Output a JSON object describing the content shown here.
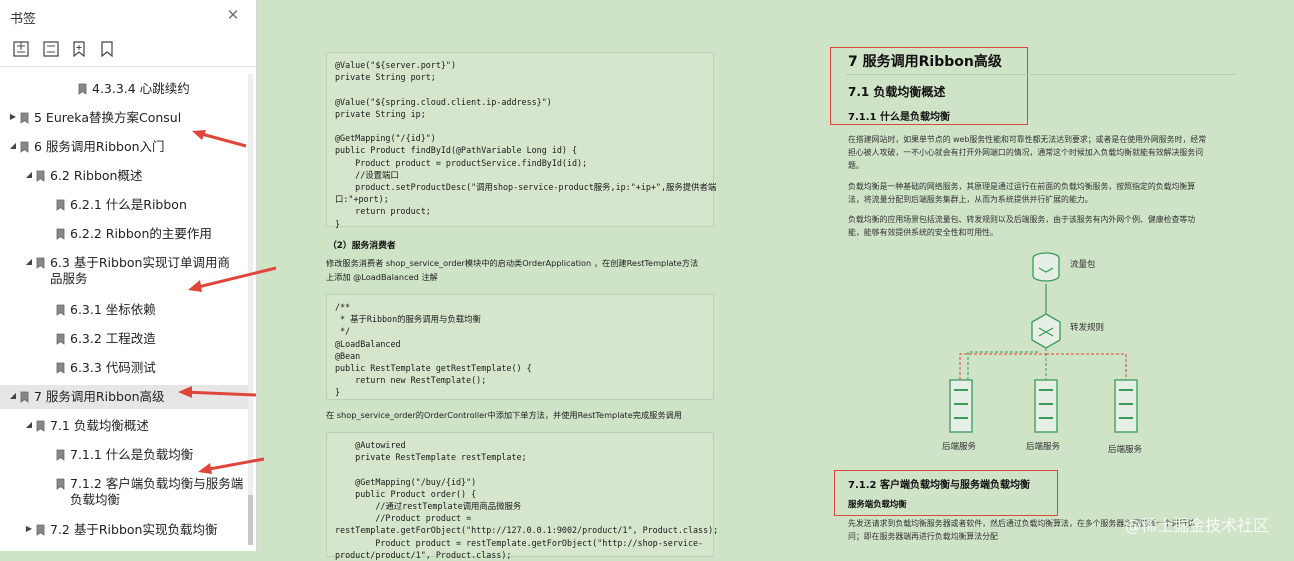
{
  "sidebar": {
    "title": "书签",
    "tools": [
      "expand-all-icon",
      "collapse-all-icon",
      "add-bookmark-icon",
      "bookmark-outline-icon"
    ],
    "items": [
      {
        "label": "4.3.3.4 心跳续约",
        "level": 3,
        "caret": "none"
      },
      {
        "label": "5 Eureka替换方案Consul",
        "level": 0,
        "caret": "right"
      },
      {
        "label": "6 服务调用Ribbon入门",
        "level": 0,
        "caret": "down"
      },
      {
        "label": "6.2 Ribbon概述",
        "level": 1,
        "caret": "down"
      },
      {
        "label": "6.2.1 什么是Ribbon",
        "level": 2,
        "caret": "none"
      },
      {
        "label": "6.2.2 Ribbon的主要作用",
        "level": 2,
        "caret": "none"
      },
      {
        "label": "6.3 基于Ribbon实现订单调用商",
        "label2": "品服务",
        "level": 1,
        "caret": "down"
      },
      {
        "label": "6.3.1 坐标依赖",
        "level": 2,
        "caret": "none"
      },
      {
        "label": "6.3.2 工程改造",
        "level": 2,
        "caret": "none"
      },
      {
        "label": "6.3.3 代码测试",
        "level": 2,
        "caret": "none"
      },
      {
        "label": "7 服务调用Ribbon高级",
        "level": 0,
        "caret": "down",
        "selected": true
      },
      {
        "label": "7.1 负载均衡概述",
        "level": 1,
        "caret": "down"
      },
      {
        "label": "7.1.1 什么是负载均衡",
        "level": 2,
        "caret": "none"
      },
      {
        "label": "7.1.2 客户端负载均衡与服务端",
        "label2": "负载均衡",
        "level": 2,
        "caret": "none"
      },
      {
        "label": "7.2 基于Ribbon实现负载均衡",
        "level": 1,
        "caret": "right"
      }
    ]
  },
  "left_page": {
    "code1": [
      "@Value(\"${server.port}\")",
      "private String port;",
      "",
      "@Value(\"${spring.cloud.client.ip-address}\")",
      "private String ip;",
      "",
      "@GetMapping(\"/{id}\")",
      "public Product findById(@PathVariable Long id) {",
      "    Product product = productService.findById(id);",
      "    //设置端口",
      "    product.setProductDesc(\"调用shop-service-product服务,ip:\"+ip+\",服务提供者端",
      "口:\"+port);",
      "    return product;",
      "}"
    ],
    "consumer_heading": "（2）服务消费者",
    "para1": "修改服务消费者 shop_service_order模块中的启动类OrderApplication ，在创建RestTemplate方法",
    "para1b": "上添加 @LoadBalanced 注解",
    "code2": [
      "/**",
      " * 基于Ribbon的服务调用与负载均衡",
      " */",
      "@LoadBalanced",
      "@Bean",
      "public RestTemplate getRestTemplate() {",
      "    return new RestTemplate();",
      "}"
    ],
    "para2": "在 shop_service_order的OrderController中添加下单方法，并使用RestTemplate完成服务调用",
    "code3": [
      "    @Autowired",
      "    private RestTemplate restTemplate;",
      "",
      "    @GetMapping(\"/buy/{id}\")",
      "    public Product order() {",
      "        //通过restTemplate调用商品微服务",
      "        //Product product =",
      "restTemplate.getForObject(\"http://127.0.0.1:9002/product/1\", Product.class);",
      "        Product product = restTemplate.getForObject(\"http://shop-service-",
      "product/product/1\", Product.class);"
    ]
  },
  "right_page": {
    "h1": "7 服务调用Ribbon高级",
    "h2": "7.1 负载均衡概述",
    "h3": "7.1.1 什么是负载均衡",
    "p1a": "在搭建网站时，如果单节点的 web服务性能和可靠性都无法达到要求；或者是在使用外网服务时，经常",
    "p1b": "担心被人攻破，一不小心就会有打开外网端口的情况，通常这个时候加入负载均衡就能有效解决服务问",
    "p1c": "题。",
    "p2a": "负载均衡是一种基础的网络服务，其原理是通过运行在前面的负载均衡服务，按照指定的负载均衡算",
    "p2b": "法，将流量分配到后端服务集群上，从而为系统提供并行扩展的能力。",
    "p3a": "负载均衡的应用场景包括流量包、转发规则以及后端服务，由于该服务有内外网个例、健康检查等功",
    "p3b": "能，能够有效提供系统的安全性和可用性。",
    "diagram": {
      "traffic": "流量包",
      "rule": "转发规则",
      "backend": [
        "后端服务",
        "后端服务",
        "后端服务"
      ]
    },
    "h3b": "7.1.2 客户端负载均衡与服务端负载均衡",
    "h4": "服务端负载均衡",
    "p4a": "先发送请求到负载均衡服务器或者软件，然后通过负载均衡算法，在多个服务器之间选择一个进行访",
    "p4b": "问；即在服务器端再进行负载均衡算法分配"
  },
  "watermark": "@稀土掘金技术社区",
  "colors": {
    "page_bg": "#cfe3c7",
    "annotation_red": "#e0453a",
    "diagram_green": "#3a9a5a"
  }
}
